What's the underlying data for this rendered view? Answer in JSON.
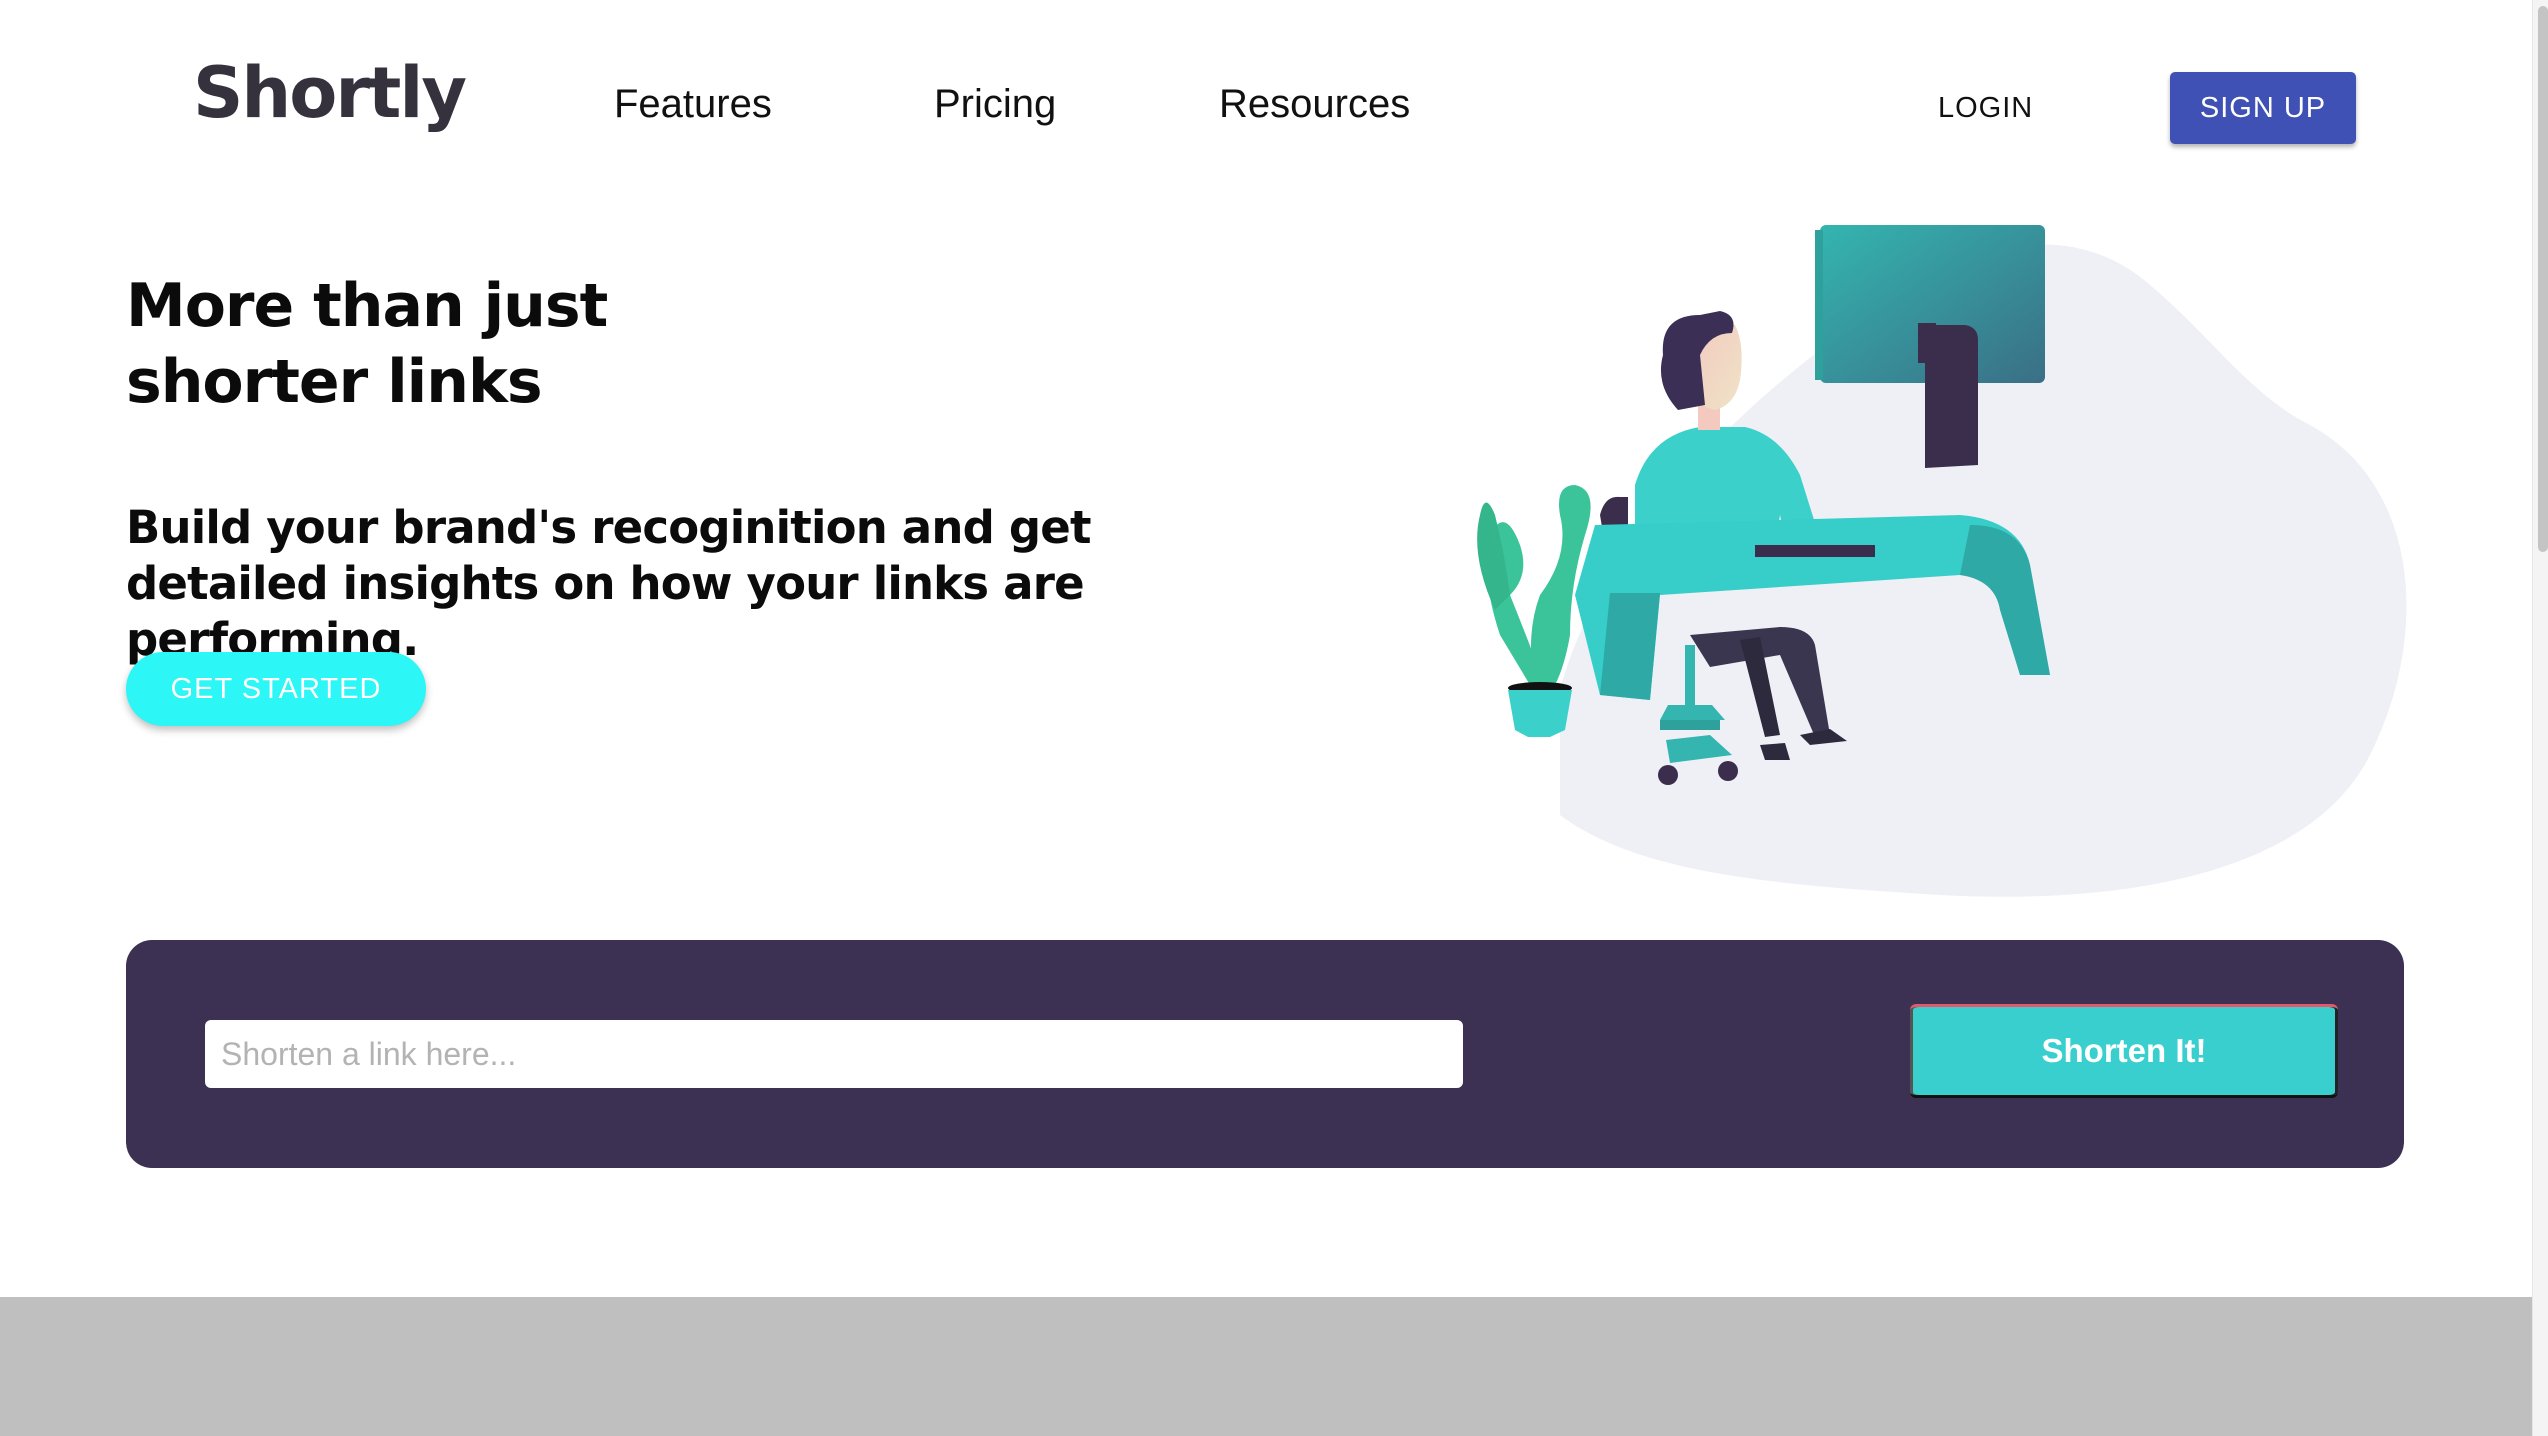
{
  "header": {
    "logo": "Shortly",
    "nav": [
      "Features",
      "Pricing",
      "Resources"
    ],
    "login_label": "LOGIN",
    "signup_label": "SIGN UP"
  },
  "hero": {
    "title_line1": "More than just",
    "title_line2": "shorter links",
    "subtitle": "Build your brand's recoginition and get detailed insights on how your links are performing.",
    "cta_label": "GET STARTED"
  },
  "shorten": {
    "placeholder": "Shorten a link here...",
    "value": "",
    "button_label": "Shorten It!"
  },
  "colors": {
    "brand_dark": "#3c3152",
    "accent_cyan": "#2cf6f6",
    "accent_teal": "#39cfcf",
    "signup_blue": "#3f51b5",
    "footer_gray": "#bfbfbf"
  }
}
